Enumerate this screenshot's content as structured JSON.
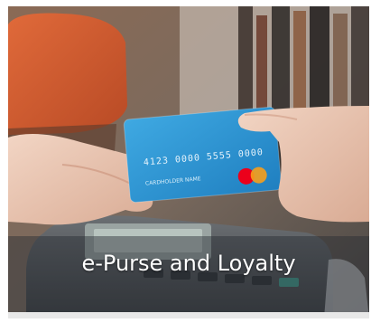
{
  "tile": {
    "caption": "e-Purse and Loyalty"
  },
  "card": {
    "number": "4123 0000 5555 0000",
    "holder": "CARDHOLDER NAME",
    "color": "#2f9bd6",
    "brand_colors": [
      "#eb001b",
      "#f79e1b"
    ]
  },
  "icons": {
    "card_brand": "mastercard-logo-icon"
  }
}
